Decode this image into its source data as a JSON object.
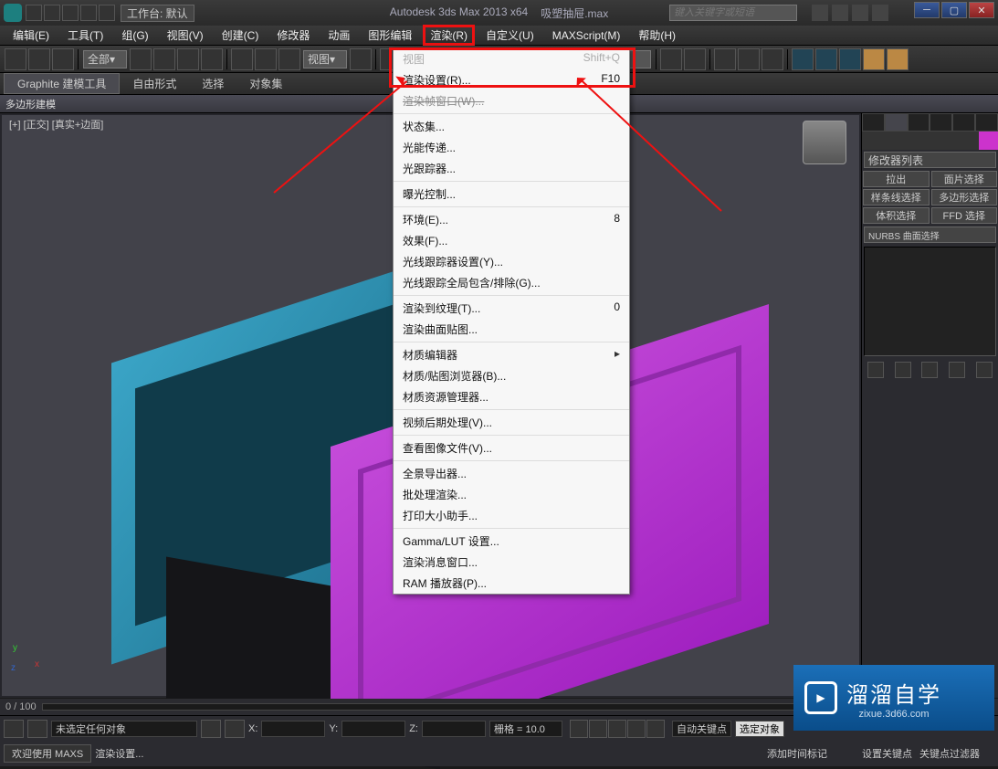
{
  "title": {
    "app": "Autodesk 3ds Max 2013 x64",
    "file": "吸塑抽屉.max"
  },
  "searchPlaceholder": "键入关键字或短语",
  "workspace": "工作台: 默认",
  "menus": [
    "编辑(E)",
    "工具(T)",
    "组(G)",
    "视图(V)",
    "创建(C)",
    "修改器",
    "动画",
    "图形编辑",
    "渲染(R)",
    "自定义(U)",
    "MAXScript(M)",
    "帮助(H)"
  ],
  "toolbar": {
    "view_label": "视图",
    "filter_all": "全部"
  },
  "ribbon": {
    "tabs": [
      "Graphite 建模工具",
      "自由形式",
      "选择",
      "对象集"
    ],
    "sub": "多边形建模"
  },
  "viewportTag": "[+] [正交] [真实+边面]",
  "rpanel": {
    "listHeader": "修改器列表",
    "btns": [
      [
        "拉出",
        "面片选择"
      ],
      [
        "样条线选择",
        "多边形选择"
      ],
      [
        "体积选择",
        "FFD 选择"
      ]
    ],
    "extra": "NURBS 曲面选择"
  },
  "renderMenu": {
    "topRow": {
      "l": "视图",
      "r": "Shift+Q"
    },
    "items": [
      {
        "l": "渲染设置(R)...",
        "r": "F10",
        "hl": true
      },
      {
        "l": "渲染帧窗口(W)...",
        "strike": true
      },
      {
        "sep": true
      },
      {
        "l": "状态集..."
      },
      {
        "l": "光能传递..."
      },
      {
        "l": "光跟踪器..."
      },
      {
        "sep": true
      },
      {
        "l": "曝光控制..."
      },
      {
        "sep": true
      },
      {
        "l": "环境(E)...",
        "r": "8"
      },
      {
        "l": "效果(F)..."
      },
      {
        "l": "光线跟踪器设置(Y)..."
      },
      {
        "l": "光线跟踪全局包含/排除(G)..."
      },
      {
        "sep": true
      },
      {
        "l": "渲染到纹理(T)...",
        "r": "0"
      },
      {
        "l": "渲染曲面贴图..."
      },
      {
        "sep": true
      },
      {
        "l": "材质编辑器",
        "sub": true
      },
      {
        "l": "材质/贴图浏览器(B)..."
      },
      {
        "l": "材质资源管理器..."
      },
      {
        "sep": true
      },
      {
        "l": "视频后期处理(V)..."
      },
      {
        "sep": true
      },
      {
        "l": "查看图像文件(V)..."
      },
      {
        "sep": true
      },
      {
        "l": "全景导出器..."
      },
      {
        "l": "批处理渲染..."
      },
      {
        "l": "打印大小助手..."
      },
      {
        "sep": true
      },
      {
        "l": "Gamma/LUT 设置..."
      },
      {
        "l": "渲染消息窗口..."
      },
      {
        "l": "RAM 播放器(P)..."
      }
    ]
  },
  "timeline": {
    "text": "0 / 100"
  },
  "status": {
    "noSelection": "未选定任何对象",
    "x": "X:",
    "y": "Y:",
    "z": "Z:",
    "grid": "栅格 = 10.0",
    "autoKey": "自动关键点",
    "selObj": "选定对象",
    "setKey": "设置关键点",
    "keyFilter": "关键点过滤器",
    "welcome": "欢迎使用 MAXS",
    "renderSet": "渲染设置...",
    "addTimeTag": "添加时间标记"
  },
  "watermark": {
    "big": "溜溜自学",
    "site": "zixue.3d66.com"
  }
}
